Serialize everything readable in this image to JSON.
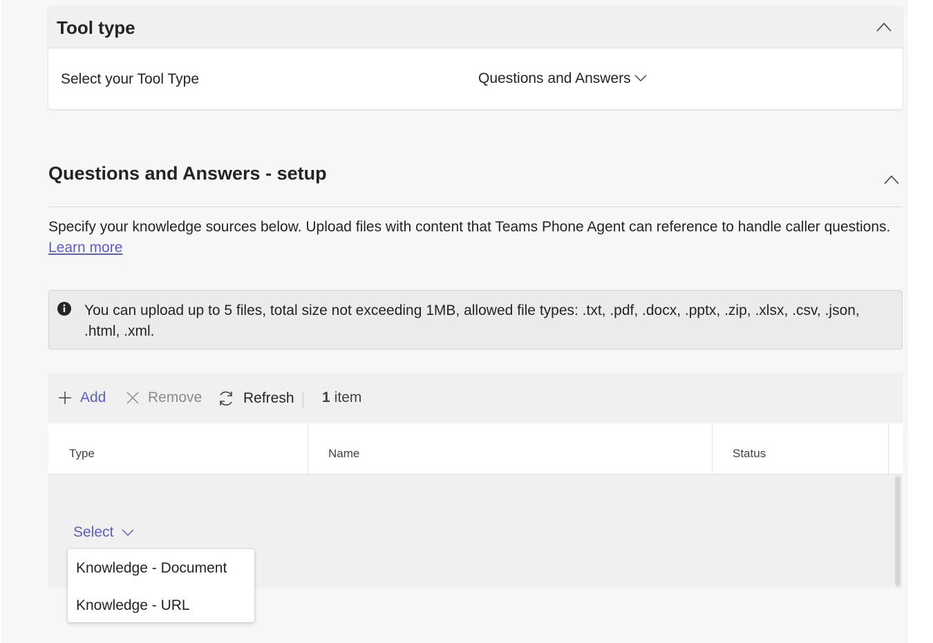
{
  "tool_type": {
    "title": "Tool type",
    "label": "Select your Tool Type",
    "selected": "Questions and Answers"
  },
  "qa_setup": {
    "title": "Questions and Answers - setup",
    "description": "Specify your knowledge sources below. Upload files with content that Teams Phone Agent can reference to handle caller questions.",
    "learn_more": "Learn more",
    "info_text": "You can upload up to 5 files, total size not exceeding 1MB, allowed file types: .txt, .pdf, .docx, .pptx, .zip, .xlsx, .csv, .json, .html, .xml."
  },
  "toolbar": {
    "add": "Add",
    "remove": "Remove",
    "refresh": "Refresh",
    "count": "1",
    "count_suffix": "item"
  },
  "table": {
    "columns": [
      "Type",
      "Name",
      "Status"
    ],
    "row_type_select": "Select"
  },
  "type_dropdown": {
    "options": [
      "Knowledge - Document",
      "Knowledge - URL"
    ]
  },
  "icons": {
    "collapse": "chevron-up-icon",
    "expand": "chevron-down-icon",
    "info": "info-icon",
    "add": "plus-icon",
    "remove": "close-icon",
    "refresh": "refresh-icon"
  },
  "colors": {
    "accent": "#5b5fc7",
    "disabled": "#8a8a8a"
  }
}
